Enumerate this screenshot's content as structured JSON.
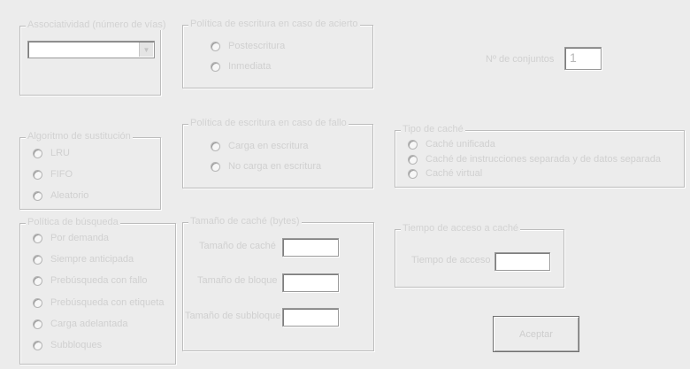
{
  "associativity": {
    "title": "Associatividad (número de vías)",
    "select": {
      "value": ""
    }
  },
  "write_hit_policy": {
    "title": "Política de escritura en caso de acierto",
    "options": [
      "Postescritura",
      "Inmediata"
    ]
  },
  "num_sets": {
    "label": "Nº de conjuntos",
    "value": "1"
  },
  "replacement": {
    "title": "Algoritmo de sustitución",
    "options": [
      "LRU",
      "FIFO",
      "Aleatorio"
    ]
  },
  "write_miss_policy": {
    "title": "Política de escritura en caso de fallo",
    "options": [
      "Carga en escritura",
      "No carga en escritura"
    ]
  },
  "cache_type": {
    "title": "Tipo de caché",
    "options": [
      "Caché unificada",
      "Caché de instrucciones separada y de datos separada",
      "Caché virtual"
    ]
  },
  "fetch_policy": {
    "title": "Política de búsqueda",
    "options": [
      "Por demanda",
      "Siempre anticipada",
      "Prebúsqueda con fallo",
      "Prebúsqueda con etiqueta",
      "Carga adelantada",
      "Subbloques"
    ]
  },
  "cache_size": {
    "title": "Tamaño de caché (bytes)",
    "fields": [
      {
        "label": "Tamaño de caché",
        "value": ""
      },
      {
        "label": "Tamaño de bloque",
        "value": ""
      },
      {
        "label": "Tamaño de subbloque",
        "value": ""
      }
    ]
  },
  "access_time": {
    "title": "Tiempo de acceso a caché",
    "field": {
      "label": "Tiempo de acceso",
      "value": ""
    }
  },
  "accept_button": {
    "label": "Aceptar"
  }
}
